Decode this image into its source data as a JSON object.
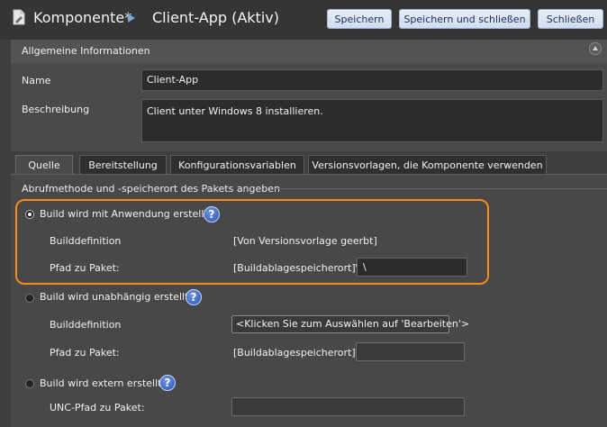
{
  "header": {
    "title": "Komponente*",
    "subtitle": "Client-App (Aktiv)",
    "buttons": {
      "save": "Speichern",
      "save_close": "Speichern und schließen",
      "close": "Schließen"
    }
  },
  "general": {
    "section_title": "Allgemeine Informationen",
    "name_label": "Name",
    "name_value": "Client-App",
    "description_label": "Beschreibung",
    "description_value": "Client unter Windows 8 installieren."
  },
  "tabs": [
    {
      "label": "Quelle",
      "active": true
    },
    {
      "label": "Bereitstellung",
      "active": false
    },
    {
      "label": "Konfigurationsvariablen",
      "active": false
    },
    {
      "label": "Versionsvorlagen, die Komponente verwenden",
      "active": false
    }
  ],
  "source": {
    "group_label": "Abrufmethode und -speicherort des Pakets angeben",
    "options": [
      {
        "label": "Build wird mit Anwendung erstellt",
        "selected": true,
        "build_definition_label": "Builddefinition",
        "build_definition_value": "[Von Versionsvorlage geerbt]",
        "path_label": "Pfad zu Paket:",
        "path_prefix": "[Buildablagespeicherort]\\",
        "path_value": "\\"
      },
      {
        "label": "Build wird unabhängig erstellt",
        "selected": false,
        "build_definition_label": "Builddefinition",
        "build_definition_value": "<Klicken Sie zum Auswählen auf 'Bearbeiten'>",
        "path_label": "Pfad zu Paket:",
        "path_prefix": "[Buildablagespeicherort]\\",
        "path_value": ""
      },
      {
        "label": "Build wird extern erstellt",
        "selected": false,
        "unc_label": "UNC-Pfad zu Paket:",
        "unc_value": ""
      }
    ],
    "help_glyph": "?"
  },
  "colors": {
    "highlight": "#f28c1c",
    "button_text": "#1c3163",
    "help_blue": "#2b55b8"
  },
  "icons": [
    "document-icon",
    "breadcrumb-arrow-icon",
    "collapse-icon",
    "help-icon",
    "radio-icon"
  ]
}
